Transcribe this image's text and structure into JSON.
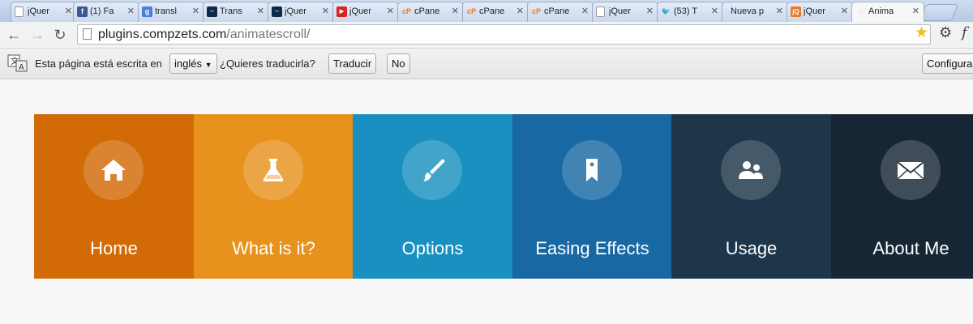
{
  "tabs": [
    {
      "title": "jQuer",
      "favicon": "page-icon"
    },
    {
      "title": "(1) Fa",
      "favicon": "facebook-icon"
    },
    {
      "title": "transl",
      "favicon": "google-icon"
    },
    {
      "title": "Trans",
      "favicon": "swirl-icon"
    },
    {
      "title": "jQuer",
      "favicon": "swirl-icon"
    },
    {
      "title": "jQuer",
      "favicon": "youtube-icon"
    },
    {
      "title": "cPane",
      "favicon": "cpanel-icon"
    },
    {
      "title": "cPane",
      "favicon": "cpanel-icon"
    },
    {
      "title": "cPane",
      "favicon": "cpanel-icon"
    },
    {
      "title": "jQuer",
      "favicon": "page-icon"
    },
    {
      "title": "(53) T",
      "favicon": "twitter-icon"
    },
    {
      "title": "Nueva p",
      "favicon": "none"
    },
    {
      "title": "jQuer",
      "favicon": "jq-icon"
    },
    {
      "title": "Anima",
      "favicon": "loading-icon",
      "active": true
    }
  ],
  "toolbar": {
    "url_host": "plugins.compzets.com",
    "url_path": "/animatescroll/"
  },
  "translate_bar": {
    "prefix": "Esta página está escrita en",
    "language": "inglés",
    "question": "¿Quieres traducirla?",
    "translate_button": "Traducir",
    "no_button": "No",
    "configure_button": "Configura"
  },
  "menu": {
    "items": [
      {
        "label": "Home",
        "icon": "home-icon",
        "color": "#d26a06"
      },
      {
        "label": "What is it?",
        "icon": "flask-icon",
        "color": "#e8921e"
      },
      {
        "label": "Options",
        "icon": "brush-icon",
        "color": "#1a90c0"
      },
      {
        "label": "Easing Effects",
        "icon": "bookmark-icon",
        "color": "#1868a3"
      },
      {
        "label": "Usage",
        "icon": "users-icon",
        "color": "#1d3649"
      },
      {
        "label": "About Me",
        "icon": "mail-icon",
        "color": "#172635"
      }
    ]
  }
}
